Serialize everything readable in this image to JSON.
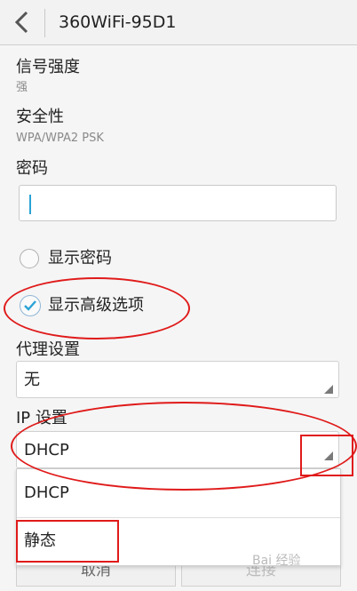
{
  "header": {
    "title": "360WiFi-95D1"
  },
  "signal": {
    "label": "信号强度",
    "value": "强"
  },
  "security": {
    "label": "安全性",
    "value": "WPA/WPA2 PSK"
  },
  "password": {
    "label": "密码",
    "value": ""
  },
  "show_password": {
    "label": "显示密码",
    "checked": false
  },
  "show_advanced": {
    "label": "显示高级选项",
    "checked": true
  },
  "proxy": {
    "label": "代理设置",
    "selected": "无"
  },
  "ip": {
    "label": "IP 设置",
    "selected": "DHCP",
    "options": [
      "DHCP",
      "静态"
    ]
  },
  "buttons": {
    "cancel": "取消",
    "connect": "连接"
  },
  "watermark": "Bai 经验",
  "colors": {
    "accent": "#2aa3d6",
    "annotation": "#e01a1a"
  }
}
